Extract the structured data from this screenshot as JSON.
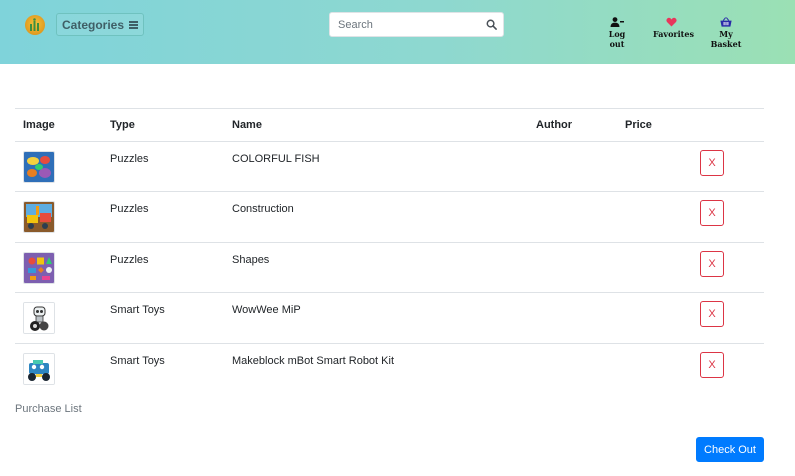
{
  "header": {
    "logo_icon": "bar-chart-logo",
    "categories_label": "Categories",
    "search_placeholder": "Search",
    "search_value": "",
    "logout_label": "Log out",
    "favorites_label": "Favorites",
    "basket_label": "My Basket",
    "accent_colors": [
      "#7fd3da",
      "#9be0b4"
    ]
  },
  "table": {
    "columns": [
      "Image",
      "Type",
      "Name",
      "Author",
      "Price"
    ],
    "rows": [
      {
        "thumb": "colorful-fish-puzzle-image",
        "type": "Puzzles",
        "name": "COLORFUL FISH",
        "author": "",
        "price": "",
        "remove_label": "X"
      },
      {
        "thumb": "construction-puzzle-image",
        "type": "Puzzles",
        "name": "Construction",
        "author": "",
        "price": "",
        "remove_label": "X"
      },
      {
        "thumb": "shapes-puzzle-image",
        "type": "Puzzles",
        "name": "Shapes",
        "author": "",
        "price": "",
        "remove_label": "X"
      },
      {
        "thumb": "wowwee-mip-robot-image",
        "type": "Smart Toys",
        "name": "WowWee MiP",
        "author": "",
        "price": "",
        "remove_label": "X"
      },
      {
        "thumb": "mbot-robot-kit-image",
        "type": "Smart Toys",
        "name": "Makeblock mBot Smart Robot Kit",
        "author": "",
        "price": "",
        "remove_label": "X"
      }
    ]
  },
  "footer": {
    "purchase_list_label": "Purchase List",
    "checkout_label": "Check Out",
    "checkout_color": "#007bff",
    "remove_color": "#dc3545"
  }
}
